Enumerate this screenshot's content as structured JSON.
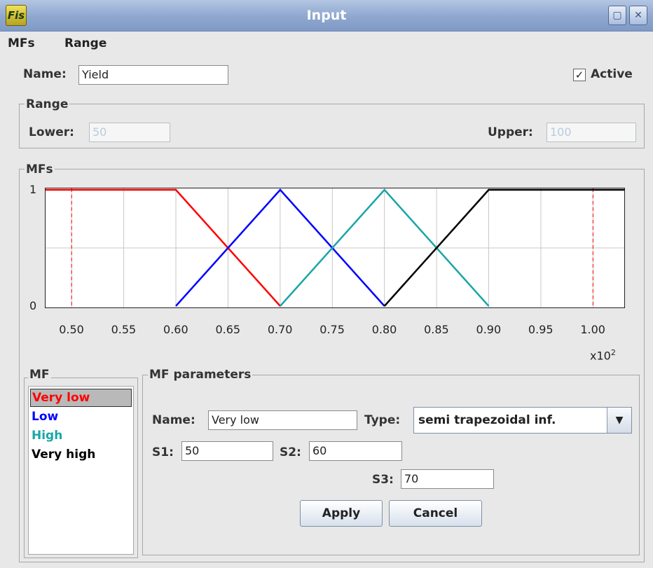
{
  "window": {
    "icon_text": "Fis",
    "title": "Input",
    "buttons": [
      "maximize",
      "close"
    ]
  },
  "menu": [
    "MFs",
    "Range"
  ],
  "name_field": {
    "label": "Name:",
    "value": "Yield"
  },
  "active": {
    "label": "Active",
    "checked": true
  },
  "range_group": {
    "title": "Range",
    "lower_label": "Lower:",
    "lower_value": "50",
    "upper_label": "Upper:",
    "upper_value": "100"
  },
  "mfs_group": {
    "title": "MFs"
  },
  "chart_data": {
    "type": "line",
    "xlim": [
      0.475,
      1.03
    ],
    "ylim": [
      0,
      1
    ],
    "x_ticks": [
      "0.50",
      "0.55",
      "0.60",
      "0.65",
      "0.70",
      "0.75",
      "0.80",
      "0.85",
      "0.90",
      "0.95",
      "1.00"
    ],
    "y_ticks": [
      "0",
      "1"
    ],
    "x_multiplier": "x10",
    "x_multiplier_exp": "2",
    "grid": true,
    "range_markers": [
      0.5,
      1.0
    ],
    "series": [
      {
        "name": "Very low",
        "color": "#ff0000",
        "points": [
          [
            0.475,
            1
          ],
          [
            0.6,
            1
          ],
          [
            0.7,
            0
          ]
        ]
      },
      {
        "name": "Low",
        "color": "#0000ff",
        "points": [
          [
            0.6,
            0
          ],
          [
            0.7,
            1
          ],
          [
            0.8,
            0
          ]
        ]
      },
      {
        "name": "High",
        "color": "#1aa6a6",
        "points": [
          [
            0.7,
            0
          ],
          [
            0.8,
            1
          ],
          [
            0.9,
            0
          ]
        ]
      },
      {
        "name": "Very high",
        "color": "#000000",
        "points": [
          [
            0.8,
            0
          ],
          [
            0.9,
            1
          ],
          [
            1.03,
            1
          ]
        ]
      }
    ]
  },
  "mf_list": {
    "title": "MF",
    "items": [
      {
        "label": "Very low",
        "color": "#ff0000",
        "selected": true
      },
      {
        "label": "Low",
        "color": "#0000ff",
        "selected": false
      },
      {
        "label": "High",
        "color": "#1aa6a6",
        "selected": false
      },
      {
        "label": "Very high",
        "color": "#000000",
        "selected": false
      }
    ]
  },
  "mf_params": {
    "title": "MF parameters",
    "name_label": "Name:",
    "name_value": "Very low",
    "type_label": "Type:",
    "type_value": "semi trapezoidal inf.",
    "s1_label": "S1:",
    "s1_value": "50",
    "s2_label": "S2:",
    "s2_value": "60",
    "s3_label": "S3:",
    "s3_value": "70",
    "apply_label": "Apply",
    "cancel_label": "Cancel"
  }
}
